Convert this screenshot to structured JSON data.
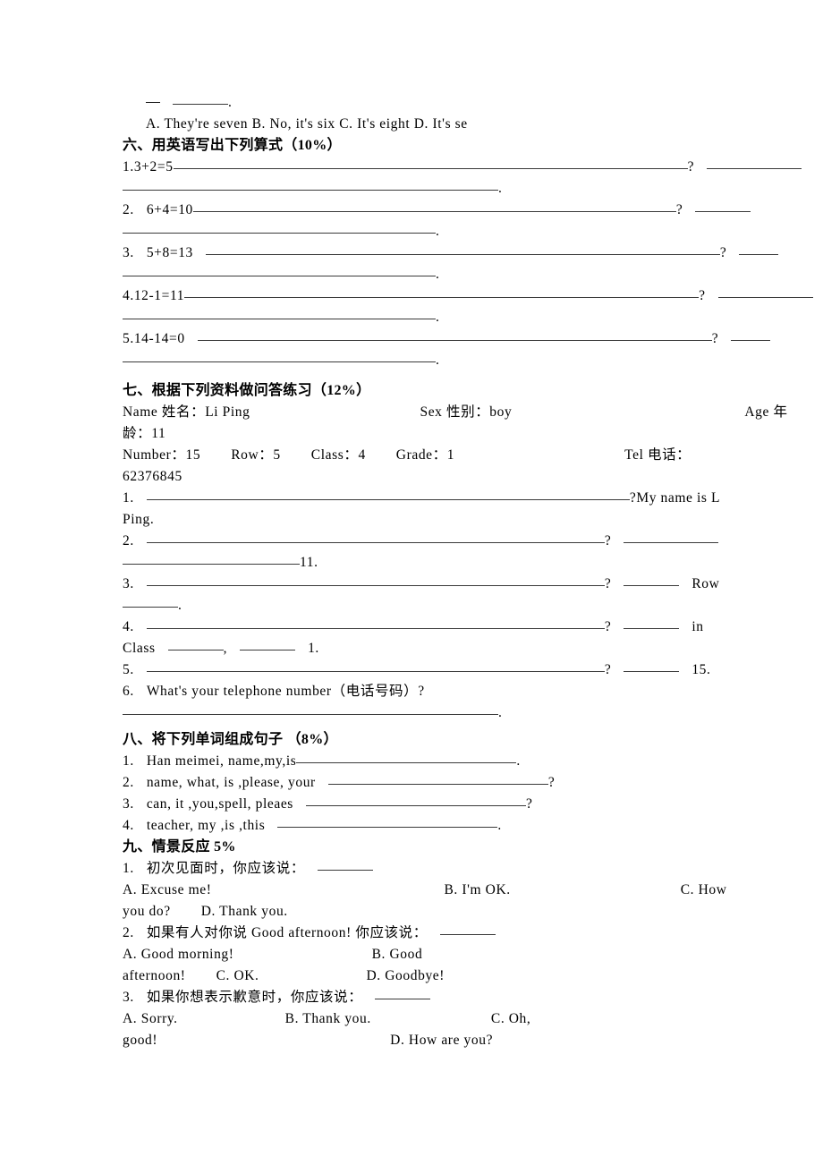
{
  "document": {
    "type": "english-exam-worksheet",
    "language": "zh-CN + en"
  },
  "top_fragment": {
    "blank_line_suffix": ".",
    "choices_line": "A. They're seven     B. No, it's six     C. It's eight  D. It's se"
  },
  "section_six": {
    "heading": "六、用英语写出下列算式（10%）",
    "items": [
      {
        "number": "1.",
        "equation": "3+2=5",
        "q_mark": "?",
        "period": "."
      },
      {
        "number": "2.",
        "equation": "6+4=10",
        "q_mark": "?",
        "period": "."
      },
      {
        "number": "3.",
        "equation": "5+8=13",
        "q_mark": "?",
        "period": "."
      },
      {
        "number": "4.",
        "equation": "12-1=11",
        "q_mark": "?",
        "period": "."
      },
      {
        "number": "5.",
        "equation": "14-14=0",
        "q_mark": "?",
        "period": "."
      }
    ]
  },
  "section_seven": {
    "heading": "七、根据下列资料做问答练习（12%）",
    "info_line_1": {
      "name_label": "Name 姓名：",
      "name_value": "Li Ping",
      "sex_label": "Sex 性别：",
      "sex_value": "boy",
      "age_label": "Age 年",
      "age_wrap": "龄：11"
    },
    "info_line_2": {
      "number_label": "Number：15",
      "row_label": "Row：5",
      "class_label": "Class：4",
      "grade_label": "Grade：1",
      "tel_label": "Tel 电话：",
      "tel_value": "62376845"
    },
    "questions": [
      {
        "number": "1.",
        "q_mark": "?",
        "answer": "My name is L",
        "answer_wrap": "Ping."
      },
      {
        "number": "2.",
        "q_mark": "?",
        "answer_wrap_value": "11."
      },
      {
        "number": "3.",
        "q_mark": "?",
        "tail": "Row",
        "tail_wrap": "."
      },
      {
        "number": "4.",
        "q_mark": "?",
        "tail": "in",
        "tail_wrap_a": "Class",
        "tail_wrap_b": ",",
        "tail_wrap_c": "1."
      },
      {
        "number": "5.",
        "q_mark": "?",
        "tail": "15."
      },
      {
        "number": "6.",
        "text": "What's your telephone number（电话号码）?",
        "answer_period": "."
      }
    ]
  },
  "section_eight": {
    "heading": "八、将下列单词组成句子   （8%）",
    "items": [
      {
        "number": "1.",
        "words": "Han meimei, name,my,is",
        "end": "."
      },
      {
        "number": "2.",
        "words": "name, what, is ,please, your",
        "end": "?"
      },
      {
        "number": "3.",
        "words": "can, it ,you,spell, pleaes",
        "end": "?"
      },
      {
        "number": "4.",
        "words": "teacher, my ,is ,this",
        "end": "."
      }
    ]
  },
  "section_nine": {
    "heading": "九、情景反应 5%",
    "questions": [
      {
        "number": "1.",
        "prompt": "初次见面时，你应该说：",
        "choice_a": "A. Excuse me!",
        "choice_b": "B. I'm OK.",
        "choice_c": "C. How",
        "choice_c_wrap": "you do?",
        "choice_d": "D. Thank you."
      },
      {
        "number": "2.",
        "prompt": "如果有人对你说 Good afternoon! 你应该说：",
        "choice_a": "A. Good morning!",
        "choice_b": "B. Good",
        "choice_b_wrap": "afternoon!",
        "choice_c": "C. OK.",
        "choice_d": "D. Goodbye!"
      },
      {
        "number": "3.",
        "prompt": "如果你想表示歉意时，你应该说：",
        "choice_a": "A. Sorry.",
        "choice_b": "B. Thank you.",
        "choice_c": "C. Oh,",
        "choice_c_wrap": "good!",
        "choice_d": "D. How are you?"
      }
    ]
  }
}
